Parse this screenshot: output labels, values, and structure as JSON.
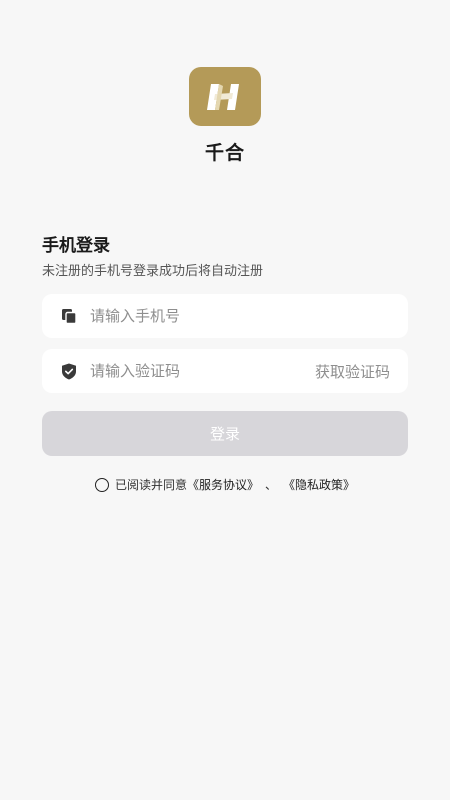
{
  "app": {
    "name": "千合",
    "logo_letter": "H",
    "logo_color": "#b49a58"
  },
  "login": {
    "title": "手机登录",
    "subtitle": "未注册的手机号登录成功后将自动注册",
    "phone_placeholder": "请输入手机号",
    "code_placeholder": "请输入验证码",
    "get_code_label": "获取验证码",
    "submit_label": "登录",
    "submit_color": "#d7d6da"
  },
  "agreement": {
    "prefix": "已阅读并同意",
    "service_link": "《服务协议》",
    "separator": "、",
    "privacy_link": "《隐私政策》"
  },
  "icons": {
    "phone_field": "phone-copy-icon",
    "code_field": "shield-check-icon",
    "agree": "radio-unchecked-icon"
  }
}
